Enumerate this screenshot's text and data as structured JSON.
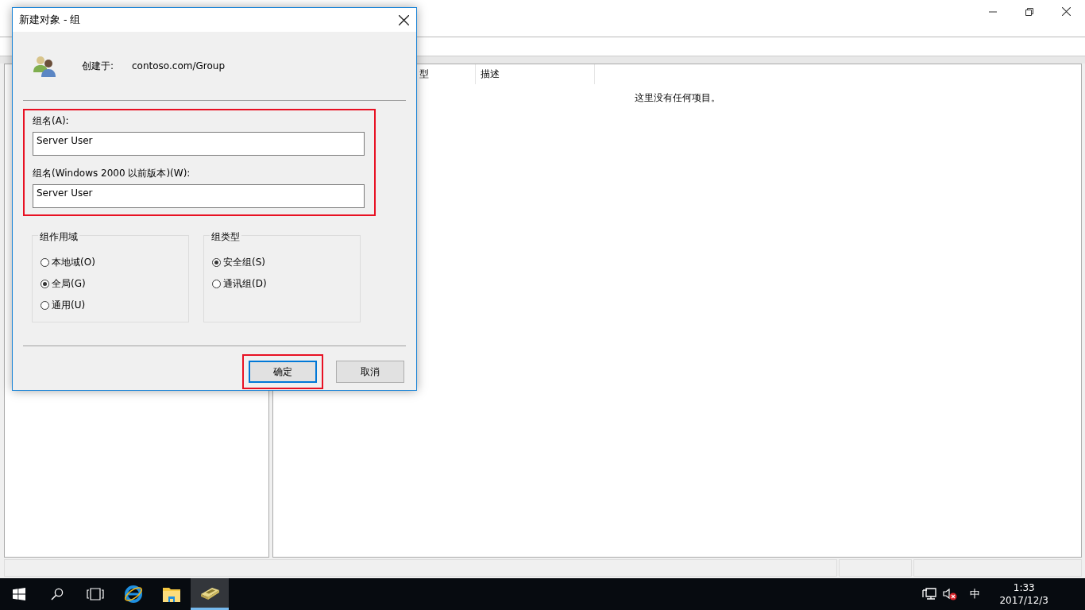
{
  "background_window": {
    "list": {
      "columns": [
        {
          "label": "型"
        },
        {
          "label": "描述"
        }
      ],
      "empty_message": "这里没有任何项目。"
    }
  },
  "dialog": {
    "title": "新建对象 - 组",
    "created_in_label": "创建于:",
    "created_in_value": "contoso.com/Group",
    "fields_highlighted": true,
    "fields": [
      {
        "label": "组名(A):",
        "value": "Server User"
      },
      {
        "label": "组名(Windows 2000 以前版本)(W):",
        "value": "Server User"
      }
    ],
    "groups": [
      {
        "title": "组作用域",
        "options": [
          {
            "label": "本地域(O)",
            "selected": false
          },
          {
            "label": "全局(G)",
            "selected": true
          },
          {
            "label": "通用(U)",
            "selected": false
          }
        ]
      },
      {
        "title": "组类型",
        "options": [
          {
            "label": "安全组(S)",
            "selected": true
          },
          {
            "label": "通讯组(D)",
            "selected": false
          }
        ]
      }
    ],
    "buttons": [
      {
        "label": "确定",
        "default": true,
        "highlighted": true
      },
      {
        "label": "取消",
        "default": false,
        "highlighted": false
      }
    ]
  },
  "taskbar": {
    "apps": [
      {
        "kind": "start",
        "active": false
      },
      {
        "kind": "search",
        "active": false
      },
      {
        "kind": "taskview",
        "active": false
      },
      {
        "kind": "browser",
        "active": false
      },
      {
        "kind": "explorer",
        "active": false
      },
      {
        "kind": "directory",
        "active": true
      }
    ],
    "tray": {
      "ime": "中",
      "time": "1:33",
      "date": "2017/12/3"
    }
  }
}
